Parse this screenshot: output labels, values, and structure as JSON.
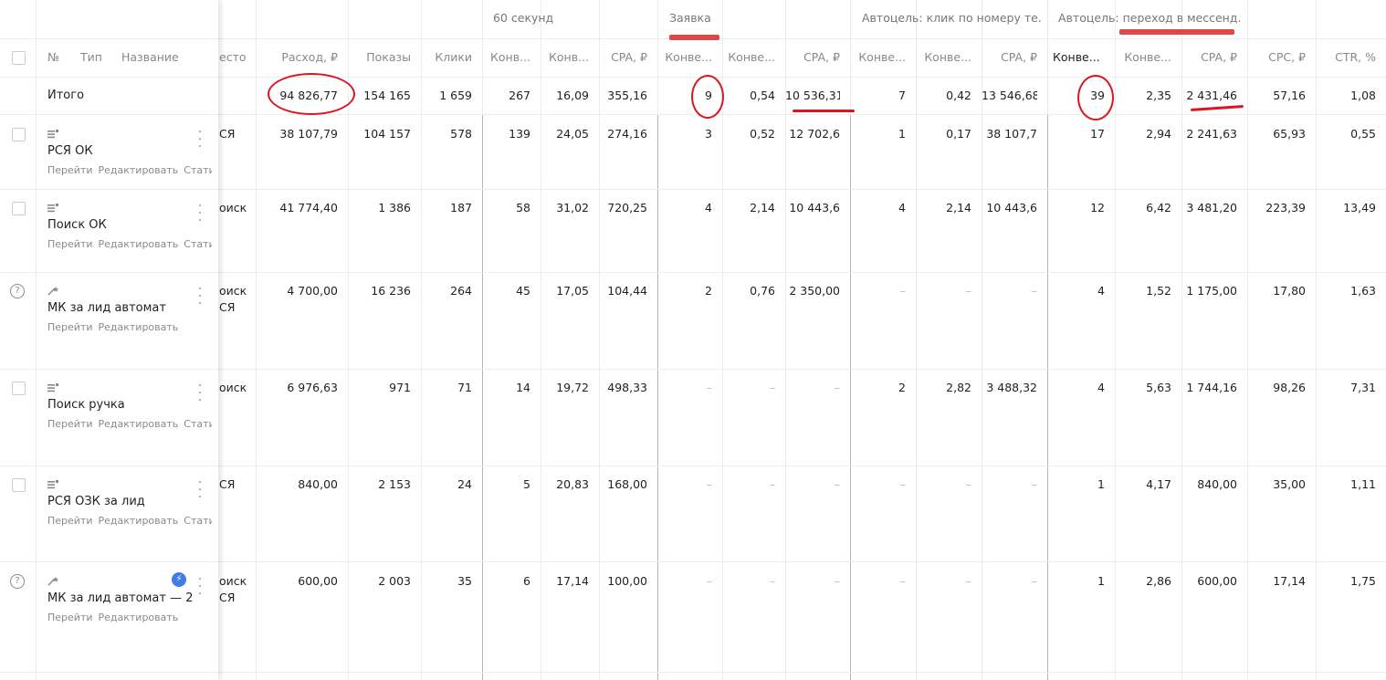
{
  "groups": {
    "sec60": "60 секунд",
    "zayavka": "Заявка",
    "autoclick": "Автоцель: клик по номеру те...",
    "automessenger": "Автоцель: переход в мессенд..."
  },
  "columns": {
    "num": "№",
    "type": "Тип",
    "name": "Название",
    "place": "есто",
    "spend": "Расход, ₽",
    "shows": "Показы",
    "clicks": "Клики",
    "conv1": "Конв...",
    "conv2": "Конв...",
    "cpa1": "CPA, ₽",
    "conv3": "Конве...",
    "conv4": "Конве...",
    "cpa2": "CPA, ₽",
    "conv5": "Конве...",
    "conv6": "Конве...",
    "cpa3": "CPA, ₽",
    "conv7": "Конве...",
    "sort_arrow": "↓",
    "conv8": "Конве...",
    "cpa4": "CPA, ₽",
    "cpc": "CPC, ₽",
    "ctr": "CTR, %"
  },
  "total": {
    "label": "Итого",
    "values": [
      "94 826,77",
      "154 165",
      "1 659",
      "267",
      "16,09",
      "355,16",
      "9",
      "0,54",
      "10 536,31",
      "7",
      "0,42",
      "13 546,68",
      "39",
      "2,35",
      "2 431,46",
      "57,16",
      "1,08"
    ]
  },
  "row_links": {
    "goto": "Перейти",
    "edit": "Редактировать",
    "stats": "Статист"
  },
  "rows": [
    {
      "name": "РСЯ ОК",
      "place1": "СЯ",
      "place2": "",
      "values": [
        "38 107,79",
        "104 157",
        "578",
        "139",
        "24,05",
        "274,16",
        "3",
        "0,52",
        "12 702,6",
        "1",
        "0,17",
        "38 107,7",
        "17",
        "2,94",
        "2 241,63",
        "65,93",
        "0,55"
      ]
    },
    {
      "name": "Поиск ОК",
      "place1": "оиск",
      "place2": "",
      "values": [
        "41 774,40",
        "1 386",
        "187",
        "58",
        "31,02",
        "720,25",
        "4",
        "2,14",
        "10 443,6",
        "4",
        "2,14",
        "10 443,6",
        "12",
        "6,42",
        "3 481,20",
        "223,39",
        "13,49"
      ]
    },
    {
      "name": "МК за лид автомат",
      "place1": "оиск",
      "place2": "СЯ",
      "values": [
        "4 700,00",
        "16 236",
        "264",
        "45",
        "17,05",
        "104,44",
        "2",
        "0,76",
        "2 350,00",
        "–",
        "–",
        "–",
        "4",
        "1,52",
        "1 175,00",
        "17,80",
        "1,63"
      ]
    },
    {
      "name": "Поиск ручка",
      "place1": "оиск",
      "place2": "",
      "values": [
        "6 976,63",
        "971",
        "71",
        "14",
        "19,72",
        "498,33",
        "–",
        "–",
        "–",
        "2",
        "2,82",
        "3 488,32",
        "4",
        "5,63",
        "1 744,16",
        "98,26",
        "7,31"
      ]
    },
    {
      "name": "РСЯ ОЗК за лид",
      "place1": "СЯ",
      "place2": "",
      "values": [
        "840,00",
        "2 153",
        "24",
        "5",
        "20,83",
        "168,00",
        "–",
        "–",
        "–",
        "–",
        "–",
        "–",
        "1",
        "4,17",
        "840,00",
        "35,00",
        "1,11"
      ]
    },
    {
      "name": "МК за лид автомат — 2",
      "place1": "оиск",
      "place2": "СЯ",
      "values": [
        "600,00",
        "2 003",
        "35",
        "6",
        "17,14",
        "100,00",
        "–",
        "–",
        "–",
        "–",
        "–",
        "–",
        "1",
        "2,86",
        "600,00",
        "17,14",
        "1,75"
      ]
    }
  ]
}
